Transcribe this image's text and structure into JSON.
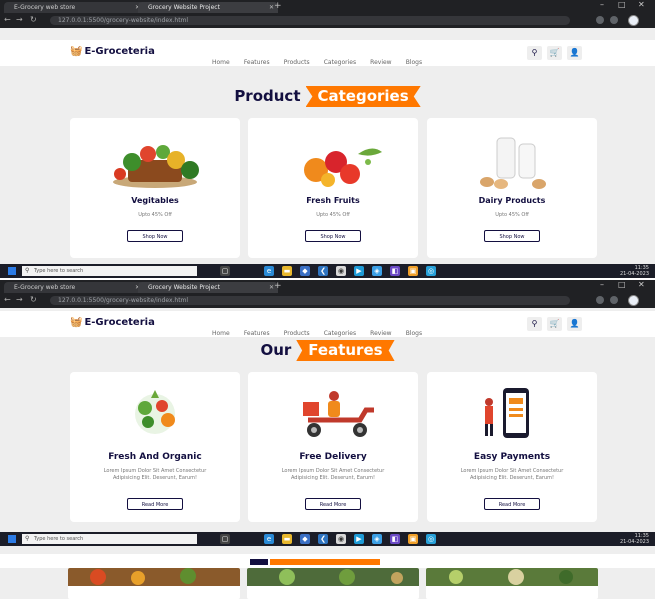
{
  "browser": {
    "tabs": [
      {
        "label": "E-Grocery web store"
      },
      {
        "label": "Grocery Website Project"
      }
    ],
    "address": "127.0.0.1:5500/grocery-website/index.html"
  },
  "site": {
    "logo": "E-Groceteria",
    "nav": [
      "Home",
      "Features",
      "Products",
      "Categories",
      "Review",
      "Blogs"
    ]
  },
  "categories": {
    "heading_dark": "Product",
    "heading_accent": "Categories",
    "cards": [
      {
        "title": "Vegitables",
        "sub": "Upto 45% Off",
        "button": "Shop Now"
      },
      {
        "title": "Fresh Fruits",
        "sub": "Upto 45% Off",
        "button": "Shop Now"
      },
      {
        "title": "Dairy Products",
        "sub": "Upto 45% Off",
        "button": "Shop Now"
      }
    ]
  },
  "features": {
    "heading_dark": "Our",
    "heading_accent": "Features",
    "cards": [
      {
        "title": "Fresh And Organic",
        "desc": "Lorem Ipsum Dolor Sit Amet Consectetur Adipisicing Elit. Deserunt, Earum!",
        "button": "Read More"
      },
      {
        "title": "Free Delivery",
        "desc": "Lorem Ipsum Dolor Sit Amet Consectetur Adipisicing Elit. Deserunt, Earum!",
        "button": "Read More"
      },
      {
        "title": "Easy Payments",
        "desc": "Lorem Ipsum Dolor Sit Amet Consectetur Adipisicing Elit. Deserunt, Earum!",
        "button": "Read More"
      }
    ]
  },
  "taskbar": {
    "search_placeholder": "Type here to search",
    "time": "11:35",
    "date": "21-04-2023"
  },
  "colors": {
    "accent": "#ff7800",
    "dark": "#130f40"
  }
}
